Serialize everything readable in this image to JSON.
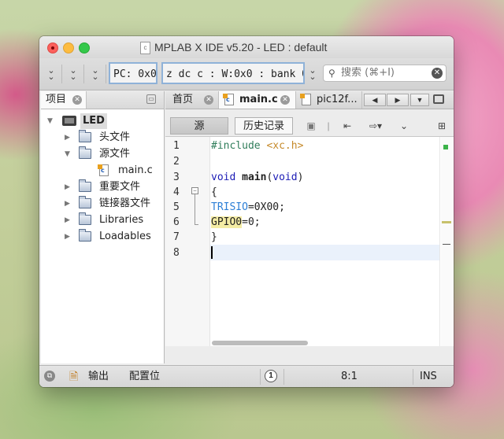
{
  "window": {
    "title": "MPLAB X IDE v5.20 - LED : default",
    "title_icon": "c"
  },
  "toolbar": {
    "pc_display": "PC: 0x0",
    "status_display": "z dc c  : W:0x0 : bank 0",
    "search": {
      "placeholder": "搜索 (⌘+I)"
    }
  },
  "left_panel": {
    "tab_label": "项目",
    "tree": {
      "project": "LED",
      "items": [
        {
          "label": "头文件"
        },
        {
          "label": "源文件"
        },
        {
          "label": "main.c"
        },
        {
          "label": "重要文件"
        },
        {
          "label": "链接器文件"
        },
        {
          "label": "Libraries"
        },
        {
          "label": "Loadables"
        }
      ]
    }
  },
  "editor": {
    "tabs": [
      {
        "label": "首页"
      },
      {
        "label": "main.c"
      },
      {
        "label": "pic12f..."
      }
    ],
    "source_button": "源",
    "history_button": "历史记录",
    "line_numbers": [
      "1",
      "2",
      "3",
      "4",
      "5",
      "6",
      "7",
      "8"
    ],
    "code": {
      "l1_directive": "#include",
      "l1_header": "<xc.h>",
      "l3_type": "void",
      "l3_name": "main",
      "l3_open": "(",
      "l3_param": "void",
      "l3_close": ")",
      "l4": "{",
      "l5_reg": "TRISIO",
      "l5_val": "=0X00;",
      "l6_reg": "GPIO0",
      "l6_val": "=0;",
      "l7": "}"
    }
  },
  "statusbar": {
    "output_label": "输出",
    "config_label": "配置位",
    "notification_count": "1",
    "cursor_position": "8:1",
    "insert_mode": "INS"
  },
  "colors": {
    "keyword": "#1b1bb5",
    "preprocessor": "#2f7d5a",
    "string": "#c68a2a",
    "sfr_blue": "#2d7fd6",
    "highlight_yellow": "#f4eca4",
    "toolbar_box_border": "#8fb2d8"
  }
}
